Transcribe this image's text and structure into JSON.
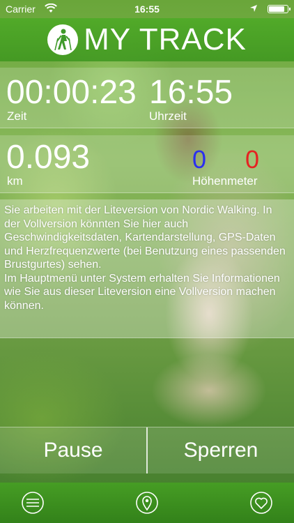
{
  "status_bar": {
    "carrier": "Carrier",
    "time": "16:55",
    "battery_level": 0.85
  },
  "header": {
    "title": "MY TRACK",
    "logo_icon": "nordic-walker-icon"
  },
  "stats": {
    "time_value": "00:00:23",
    "time_label": "Zeit",
    "clock_value": "16:55",
    "clock_label": "Uhrzeit",
    "distance_value": "0.093",
    "distance_label": "km",
    "altitude_up": "0",
    "altitude_down": "0",
    "altitude_label": "Höhenmeter",
    "altitude_up_color": "#2a2ef0",
    "altitude_down_color": "#e52222"
  },
  "info_text": "Sie arbeiten mit der Liteversion von Nordic Walking. In der Vollversion könnten Sie hier auch Geschwindigkeitsdaten, Kartendarstellung, GPS-Daten und Herzfrequenzwerte (bei Benutzung eines passenden Brustgurtes) sehen.\nIm Hauptmenü unter System erhalten Sie Informationen wie Sie aus dieser Liteversion eine Vollversion machen können.",
  "buttons": {
    "pause": "Pause",
    "lock": "Sperren"
  },
  "tabbar": {
    "items": [
      "menu-icon",
      "location-pin-icon",
      "heart-icon"
    ]
  }
}
